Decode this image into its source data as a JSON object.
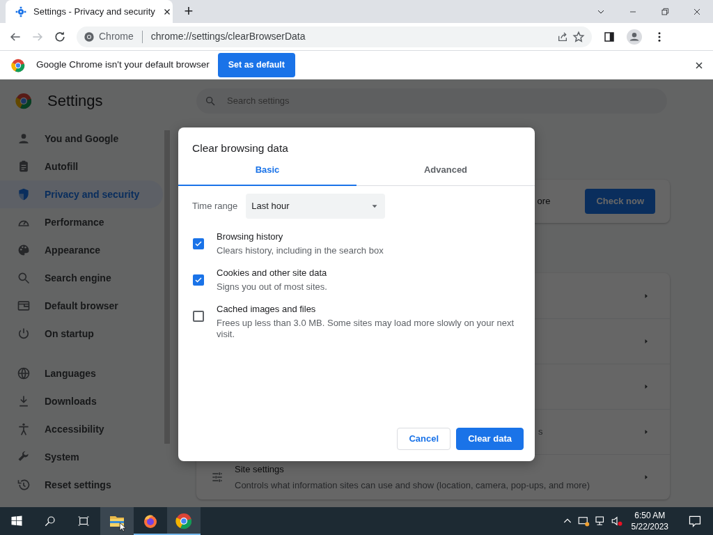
{
  "browser": {
    "tab": {
      "title": "Settings - Privacy and security"
    },
    "new_tab": "+",
    "omnibox": {
      "chip": "Chrome",
      "url": "chrome://settings/clearBrowserData"
    }
  },
  "infobar": {
    "message": "Google Chrome isn't your default browser",
    "button": "Set as default"
  },
  "settings": {
    "title": "Settings",
    "search": {
      "placeholder": "Search settings"
    },
    "sidebar": {
      "groups": [
        {
          "items": [
            {
              "label": "You and Google",
              "selected": false
            },
            {
              "label": "Autofill",
              "selected": false
            },
            {
              "label": "Privacy and security",
              "selected": true
            },
            {
              "label": "Performance",
              "selected": false
            },
            {
              "label": "Appearance",
              "selected": false
            },
            {
              "label": "Search engine",
              "selected": false
            },
            {
              "label": "Default browser",
              "selected": false
            },
            {
              "label": "On startup",
              "selected": false
            }
          ]
        },
        {
          "items": [
            {
              "label": "Languages",
              "selected": false
            },
            {
              "label": "Downloads",
              "selected": false
            },
            {
              "label": "Accessibility",
              "selected": false
            },
            {
              "label": "System",
              "selected": false
            },
            {
              "label": "Reset settings",
              "selected": false
            }
          ]
        }
      ]
    },
    "safety_check": {
      "text": "ore",
      "button": "Check now"
    },
    "rows": [
      {
        "kind": "link"
      },
      {
        "kind": "link"
      },
      {
        "kind": "link"
      },
      {
        "kind": "link",
        "subtitle": "s"
      },
      {
        "kind": "link",
        "title": "Site settings",
        "subtitle": "Controls what information sites can use and show (location, camera, pop-ups, and more)"
      }
    ]
  },
  "dialog": {
    "title": "Clear browsing data",
    "tabs": [
      {
        "label": "Basic",
        "selected": true
      },
      {
        "label": "Advanced",
        "selected": false
      }
    ],
    "time_range": {
      "label": "Time range",
      "value": "Last hour"
    },
    "options": [
      {
        "title": "Browsing history",
        "subtitle": "Clears history, including in the search box",
        "checked": true
      },
      {
        "title": "Cookies and other site data",
        "subtitle": "Signs you out of most sites.",
        "checked": true
      },
      {
        "title": "Cached images and files",
        "subtitle": "Frees up less than 3.0 MB. Some sites may load more slowly on your next visit.",
        "checked": false
      }
    ],
    "buttons": [
      {
        "label": "Cancel",
        "kind": "secondary"
      },
      {
        "label": "Clear data",
        "kind": "primary"
      }
    ]
  },
  "taskbar": {
    "apps": [
      {
        "running": false,
        "hovered": true,
        "selected": false
      },
      {
        "running": true,
        "hovered": false,
        "selected": false
      },
      {
        "running": true,
        "hovered": false,
        "selected": true
      }
    ],
    "clock": {
      "time": "6:50 AM",
      "date": "5/22/2023"
    }
  }
}
